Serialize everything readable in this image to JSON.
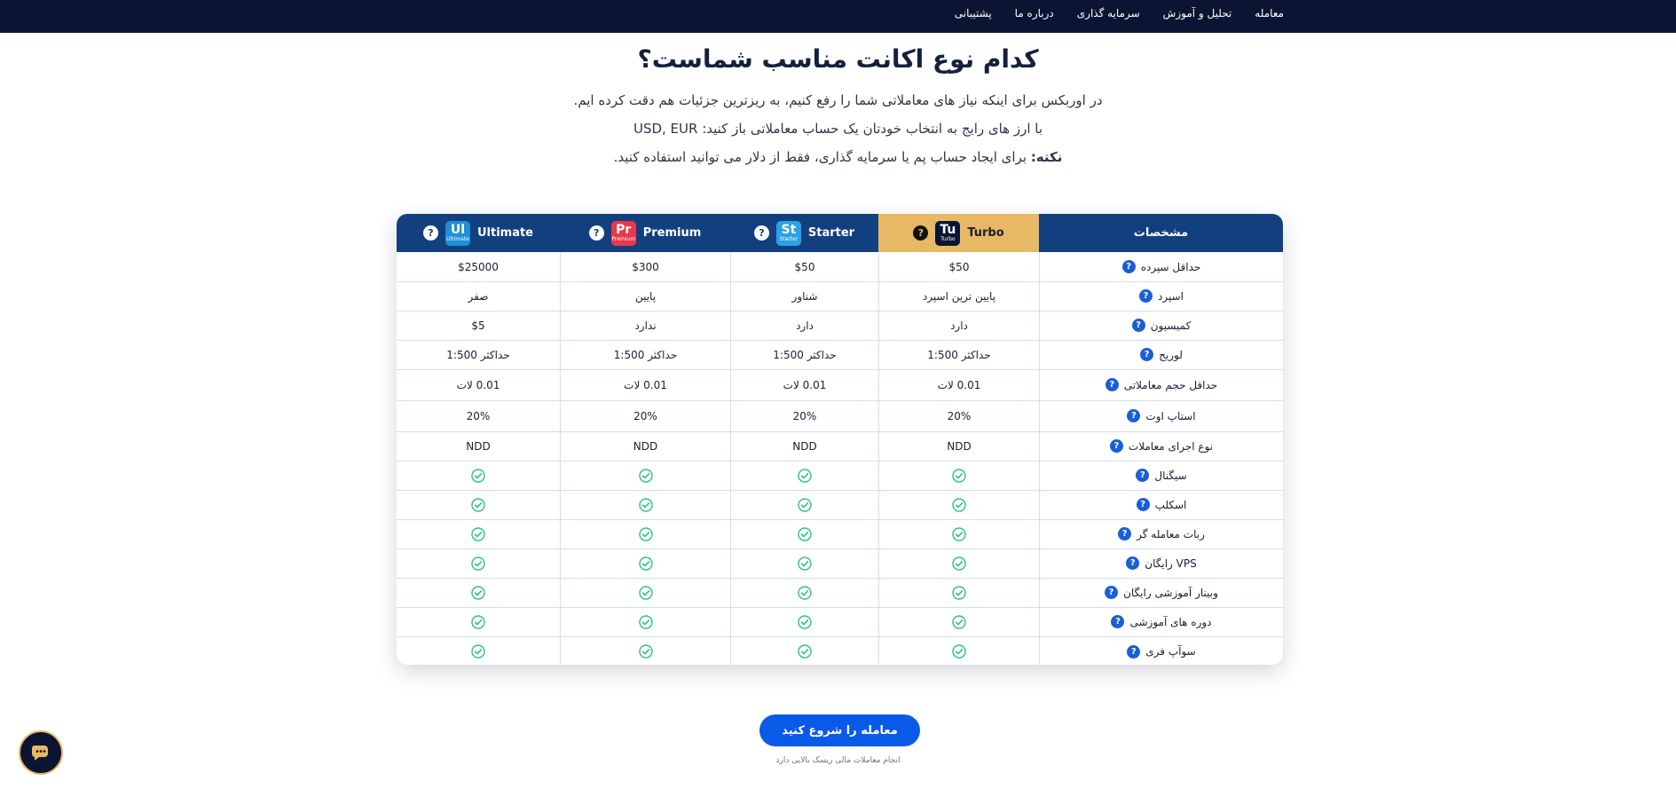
{
  "nav": {
    "items": [
      "معامله",
      "تحلیل و آموزش",
      "سرمایه گذاری",
      "درباره ما",
      "پشتیبانی"
    ]
  },
  "hero": {
    "title": "کدام نوع اکانت مناسب شماست؟",
    "line1": "در اوربکس برای اینکه نیاز های معاملاتی شما را رفع کنیم، به ریزترین جزئیات هم دقت کرده ایم.",
    "line2": "با ارز های رایج به انتخاب خودتان یک حساب معاملاتی باز کنید: USD, EUR",
    "note_label": "نکته:",
    "note_text": " برای ایجاد حساب پم یا سرمایه گذاری، فقط از دلار می توانید استفاده کنید."
  },
  "table": {
    "features_header": "مشخصات",
    "accounts": [
      {
        "name": "Turbo",
        "abbr": "Tu",
        "sub": "Turbo",
        "color": "#0b1533"
      },
      {
        "name": "Starter",
        "abbr": "St",
        "sub": "Starter",
        "color": "#29a3e6"
      },
      {
        "name": "Premium",
        "abbr": "Pr",
        "sub": "Premium",
        "color": "#e8394a"
      },
      {
        "name": "Ultimate",
        "abbr": "Ul",
        "sub": "Ultimate",
        "color": "#1f8fd8"
      }
    ],
    "rows": [
      {
        "label": "حداقل سپرده",
        "values": [
          "$50",
          "$50",
          "$300",
          "$25000"
        ]
      },
      {
        "label": "اسپرد",
        "values": [
          "پایین ترین اسپرد",
          "شناور",
          "پایین",
          "صفر"
        ]
      },
      {
        "label": "کمیسیون",
        "values": [
          "دارد",
          "دارد",
          "ندارد",
          "$5"
        ]
      },
      {
        "label": "لوریج",
        "values": [
          "حداکثر 1:500",
          "حداکثر 1:500",
          "حداکثر 1:500",
          "حداکثر 1:500"
        ]
      },
      {
        "label": "حداقل حجم معاملاتی",
        "values": [
          "0.01 لات",
          "0.01 لات",
          "0.01 لات",
          "0.01 لات"
        ]
      },
      {
        "label": "استاپ اوت",
        "values": [
          "20%",
          "20%",
          "20%",
          "20%"
        ]
      },
      {
        "label": "نوع اجرای معاملات",
        "values": [
          "NDD",
          "NDD",
          "NDD",
          "NDD"
        ]
      },
      {
        "label": "سیگنال",
        "values": [
          "check",
          "check",
          "check",
          "check"
        ]
      },
      {
        "label": "اسکلپ",
        "values": [
          "check",
          "check",
          "check",
          "check"
        ]
      },
      {
        "label": "ربات معامله گر",
        "values": [
          "check",
          "check",
          "check",
          "check"
        ]
      },
      {
        "label": "VPS رایگان",
        "values": [
          "check",
          "check",
          "check",
          "check"
        ]
      },
      {
        "label": "وبینار آموزشی رایگان",
        "values": [
          "check",
          "check",
          "check",
          "check"
        ]
      },
      {
        "label": "دوره های آموزشی",
        "values": [
          "check",
          "check",
          "check",
          "check"
        ]
      },
      {
        "label": "سوآپ فری",
        "values": [
          "check",
          "check",
          "check",
          "check"
        ]
      }
    ]
  },
  "cta": {
    "label": "معامله را شروع کنید",
    "note": "انجام معاملات مالی ریسک بالایی دارد"
  },
  "colors": {
    "nav_bg": "#0b1533",
    "header_bg": "#12407f",
    "turbo_bg": "#e8b964",
    "cta_bg": "#0a5ae8",
    "check": "#2ec27e"
  }
}
